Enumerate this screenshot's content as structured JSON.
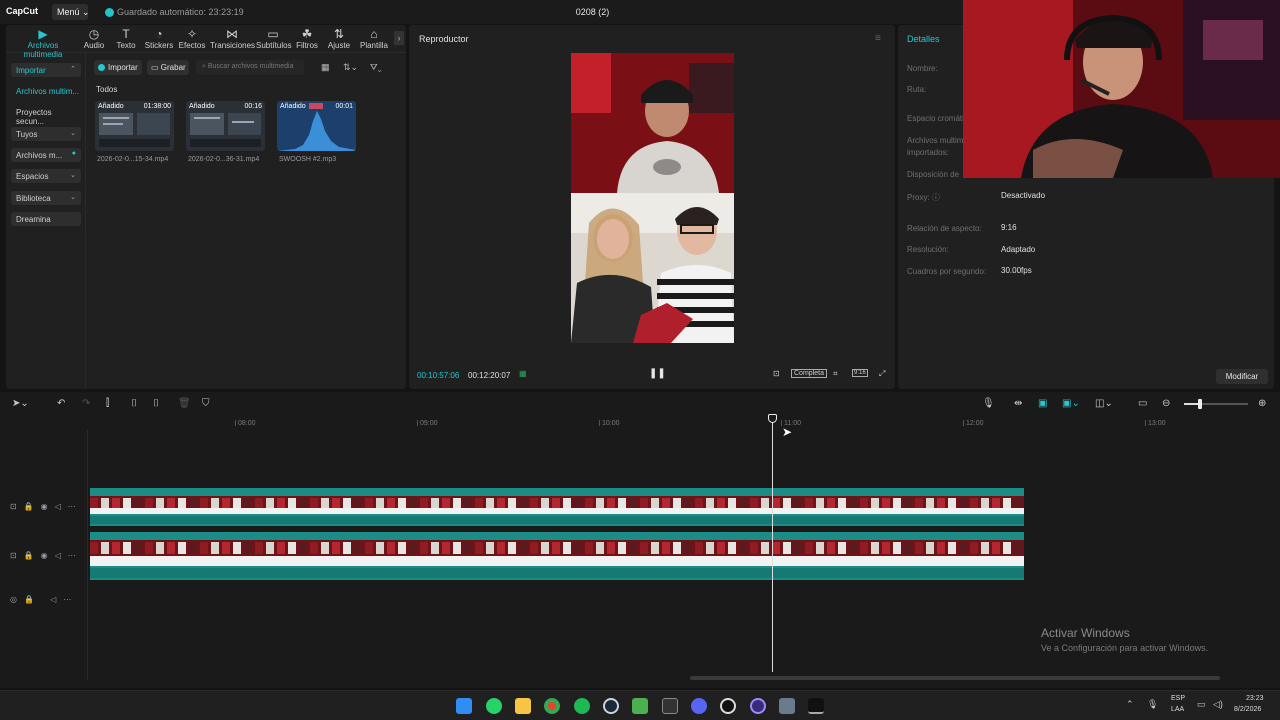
{
  "app": {
    "logo": "CapCut",
    "menu_label": "Menú",
    "autosave": "Guardado automático: 23:23:19",
    "project_title": "0208 (2)"
  },
  "tool_tabs": [
    {
      "label": "Archivos multimedia",
      "icon": "media-icon",
      "glyph": "▶",
      "active": true
    },
    {
      "label": "Audio",
      "icon": "audio-icon",
      "glyph": "◷"
    },
    {
      "label": "Texto",
      "icon": "text-icon",
      "glyph": "T"
    },
    {
      "label": "Stickers",
      "icon": "sticker-icon",
      "glyph": "◔"
    },
    {
      "label": "Efectos",
      "icon": "effects-icon",
      "glyph": "✧"
    },
    {
      "label": "Transiciones",
      "icon": "transitions-icon",
      "glyph": "⋈"
    },
    {
      "label": "Subtítulos",
      "icon": "subtitles-icon",
      "glyph": "▭"
    },
    {
      "label": "Filtros",
      "icon": "filters-icon",
      "glyph": "☘"
    },
    {
      "label": "Ajuste",
      "icon": "adjust-icon",
      "glyph": "⇅"
    },
    {
      "label": "Plantilla",
      "icon": "template-icon",
      "glyph": "⌂"
    }
  ],
  "side_nav": [
    {
      "label": "Importar",
      "chev": "⌃",
      "selected": true,
      "accent": true
    },
    {
      "label": "Archivos multim...",
      "chev": "",
      "accent": true
    },
    {
      "label": "Proyectos secun...",
      "chev": ""
    },
    {
      "label": "Tuyos",
      "chev": "⌄",
      "selected": true
    },
    {
      "label": "Archivos m...",
      "chev": "",
      "selected": true
    },
    {
      "label": "Espacios",
      "chev": "⌄",
      "selected": true
    },
    {
      "label": "Biblioteca",
      "chev": "⌄",
      "selected": true
    },
    {
      "label": "Dreamina",
      "chev": "",
      "selected": true
    }
  ],
  "media_toolbar": {
    "import_label": "Importar",
    "record_label": "Grabar",
    "search_placeholder": "Buscar archivos multimedia"
  },
  "media": {
    "filter_label": "Todos",
    "clips": [
      {
        "badge": "Añadido",
        "duration": "01:38:00",
        "name": "2026-02-0...15-34.mp4"
      },
      {
        "badge": "Añadido",
        "duration": "00:16",
        "name": "2026-02-0...36-31.mp4"
      },
      {
        "badge": "Añadido",
        "duration": "00:01",
        "name": "SWOOSH #2.mp3"
      }
    ]
  },
  "player": {
    "title": "Reproductor",
    "timecode_current": "00:10:57:06",
    "timecode_total": "00:12:20:07",
    "quality_label": "Completa",
    "ratio_label": "9:16"
  },
  "details": {
    "title": "Detalles",
    "fields": [
      {
        "label": "Nombre:",
        "value": ""
      },
      {
        "label": "Ruta:",
        "value": ""
      },
      {
        "label": "Espacio cromáti",
        "value": ""
      },
      {
        "label": "Archivos multime",
        "value": ""
      },
      {
        "label": "importados:",
        "value": ""
      },
      {
        "label": "Disposición de",
        "value": ""
      },
      {
        "label": "Proxy: ⓘ",
        "value": "Desactivado"
      },
      {
        "label": "Relación de aspecto:",
        "value": "9:16"
      },
      {
        "label": "Resolución:",
        "value": "Adaptado"
      },
      {
        "label": "Cuadros por segundo:",
        "value": "30.00fps"
      }
    ],
    "modify_label": "Modificar"
  },
  "timeline": {
    "ticks": [
      "08:00",
      "09:00",
      "10:00",
      "11:00",
      "12:00",
      "13:00"
    ]
  },
  "watermark": {
    "line1": "Activar Windows",
    "line2": "Ve a Configuración para activar Windows."
  },
  "taskbar": {
    "lang1": "ESP",
    "lang2": "LAA",
    "time": "23:23",
    "date": "8/2/2026"
  },
  "colors": {
    "accent": "#27c7cf",
    "track": "#1e8f87"
  }
}
